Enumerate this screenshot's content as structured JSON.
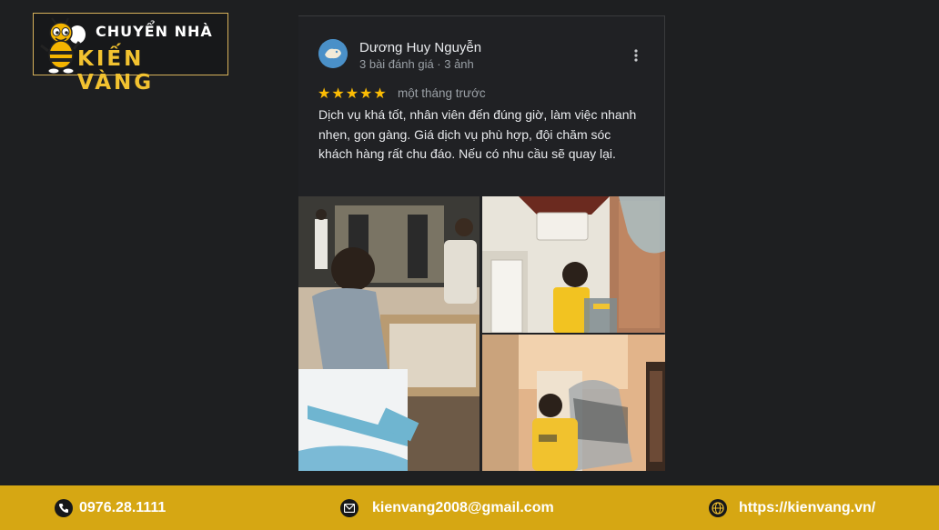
{
  "logo": {
    "line1": "CHUYỂN NHÀ",
    "line2": "KIẾN VÀNG"
  },
  "review": {
    "author": "Dương Huy Nguyễn",
    "meta": "3 bài đánh giá · 3 ảnh",
    "rating": 5,
    "stars": "★★★★★",
    "time": "một tháng trước",
    "text": "Dịch vụ khá tốt, nhân viên đến đúng giờ, làm việc nhanh nhẹn, gọn gàng. Giá dịch vụ phù hợp, đội chăm sóc khách hàng rất chu đáo. Nếu có nhu cầu sẽ quay lại.",
    "photo_count": 3
  },
  "footer": {
    "phone": "0976.28.1111",
    "email": "kienvang2008@gmail.com",
    "website": "https://kienvang.vn/"
  },
  "colors": {
    "accent_gold": "#d6a713",
    "star": "#fbbc04",
    "background": "#1e1f21"
  },
  "icons": [
    "bee-mascot-icon",
    "more-vert-icon",
    "phone-icon",
    "email-icon",
    "globe-icon"
  ]
}
